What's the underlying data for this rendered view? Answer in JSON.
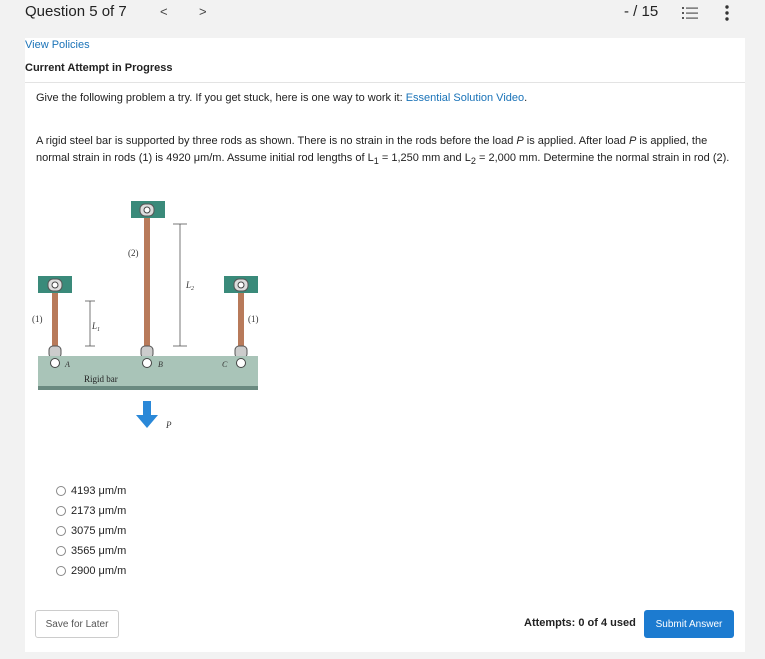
{
  "header": {
    "question_label": "Question 5 of 7",
    "prev_label": "<",
    "next_label": ">",
    "score": "- / 15"
  },
  "card": {
    "policies_link": "View Policies",
    "attempt_status": "Current Attempt in Progress",
    "intro_text": "Give the following problem a try.  If you get stuck, here is one way to work it: ",
    "intro_link": "Essential Solution Video",
    "intro_end": ".",
    "problem_parts": {
      "p1": "A rigid steel bar is supported by three rods as shown. There is no strain in the rods before the load ",
      "p_italic": "P",
      "p2": " is applied. After load ",
      "p2_italic": "P",
      "p3": " is applied, the normal strain in rods (1) is 4920 μm/m. Assume initial rod lengths of L",
      "sub1": "1",
      "p4": " = 1,250 mm and L",
      "sub2": "2",
      "p5": " = 2,000 mm. Determine the normal strain in rod (2)."
    }
  },
  "figure": {
    "rod2_label": "(2)",
    "rod1_left_label": "(1)",
    "rod1_right_label": "(1)",
    "L1_label": "L",
    "L1_sub": "1",
    "L2_label": "L",
    "L2_sub": "2",
    "point_a": "A",
    "point_b": "B",
    "point_c": "C",
    "bar_label": "Rigid bar",
    "load_label": "P"
  },
  "options": [
    {
      "label": "4193 μm/m"
    },
    {
      "label": "2173 μm/m"
    },
    {
      "label": "3075 μm/m"
    },
    {
      "label": "3565 μm/m"
    },
    {
      "label": "2900 μm/m"
    }
  ],
  "footer": {
    "save_label": "Save for Later",
    "attempts_label": "Attempts: 0 of 4 used",
    "submit_label": "Submit Answer"
  },
  "colors": {
    "link": "#1a73b8",
    "submit": "#1c7bd0",
    "bracket": "#3a8a7a",
    "rod": "#b87a5a",
    "bar": "#a9c4b8",
    "arrow": "#2a88d8"
  }
}
